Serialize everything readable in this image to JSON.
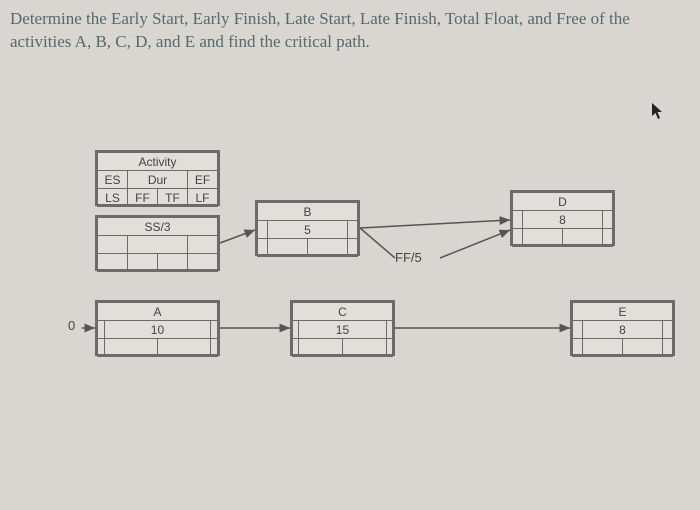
{
  "question": "Determine the Early Start, Early Finish, Late Start, Late Finish, Total Float, and Free of the activities A, B, C, D, and E and find the critical path.",
  "legend": {
    "top_center": "Activity",
    "r1c1": "ES",
    "r1c2": "Dur",
    "r1c3": "EF",
    "r2c1": "LS",
    "r2c2a": "FF",
    "r2c2b": "TF",
    "r2c3": "LF"
  },
  "nodes": {
    "ss3": {
      "name": "SS/3",
      "dur": ""
    },
    "a": {
      "name": "A",
      "dur": "10"
    },
    "b": {
      "name": "B",
      "dur": "5"
    },
    "c": {
      "name": "C",
      "dur": "15"
    },
    "d": {
      "name": "D",
      "dur": "8"
    },
    "e": {
      "name": "E",
      "dur": "8"
    }
  },
  "labels": {
    "ff5": "FF/5",
    "zero": "0"
  }
}
